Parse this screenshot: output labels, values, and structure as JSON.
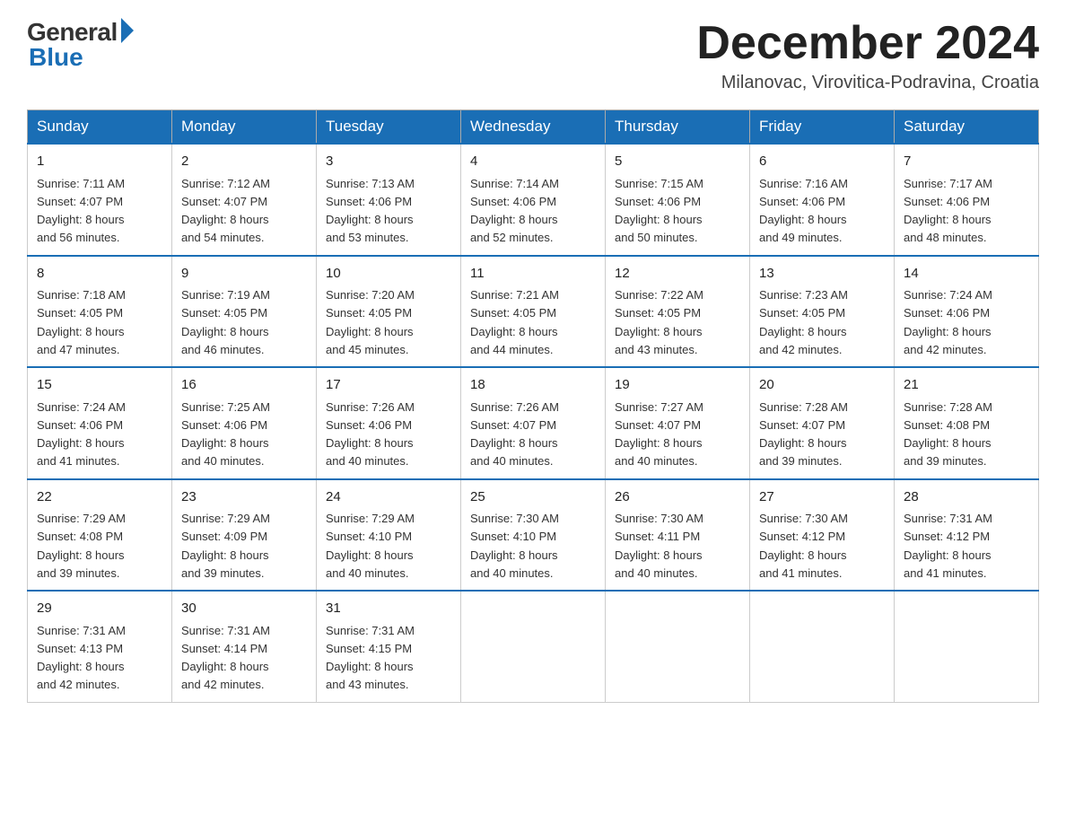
{
  "logo": {
    "general": "General",
    "blue": "Blue"
  },
  "title": {
    "month_year": "December 2024",
    "location": "Milanovac, Virovitica-Podravina, Croatia"
  },
  "headers": [
    "Sunday",
    "Monday",
    "Tuesday",
    "Wednesday",
    "Thursday",
    "Friday",
    "Saturday"
  ],
  "weeks": [
    [
      {
        "day": "1",
        "sunrise": "7:11 AM",
        "sunset": "4:07 PM",
        "daylight": "8 hours and 56 minutes."
      },
      {
        "day": "2",
        "sunrise": "7:12 AM",
        "sunset": "4:07 PM",
        "daylight": "8 hours and 54 minutes."
      },
      {
        "day": "3",
        "sunrise": "7:13 AM",
        "sunset": "4:06 PM",
        "daylight": "8 hours and 53 minutes."
      },
      {
        "day": "4",
        "sunrise": "7:14 AM",
        "sunset": "4:06 PM",
        "daylight": "8 hours and 52 minutes."
      },
      {
        "day": "5",
        "sunrise": "7:15 AM",
        "sunset": "4:06 PM",
        "daylight": "8 hours and 50 minutes."
      },
      {
        "day": "6",
        "sunrise": "7:16 AM",
        "sunset": "4:06 PM",
        "daylight": "8 hours and 49 minutes."
      },
      {
        "day": "7",
        "sunrise": "7:17 AM",
        "sunset": "4:06 PM",
        "daylight": "8 hours and 48 minutes."
      }
    ],
    [
      {
        "day": "8",
        "sunrise": "7:18 AM",
        "sunset": "4:05 PM",
        "daylight": "8 hours and 47 minutes."
      },
      {
        "day": "9",
        "sunrise": "7:19 AM",
        "sunset": "4:05 PM",
        "daylight": "8 hours and 46 minutes."
      },
      {
        "day": "10",
        "sunrise": "7:20 AM",
        "sunset": "4:05 PM",
        "daylight": "8 hours and 45 minutes."
      },
      {
        "day": "11",
        "sunrise": "7:21 AM",
        "sunset": "4:05 PM",
        "daylight": "8 hours and 44 minutes."
      },
      {
        "day": "12",
        "sunrise": "7:22 AM",
        "sunset": "4:05 PM",
        "daylight": "8 hours and 43 minutes."
      },
      {
        "day": "13",
        "sunrise": "7:23 AM",
        "sunset": "4:05 PM",
        "daylight": "8 hours and 42 minutes."
      },
      {
        "day": "14",
        "sunrise": "7:24 AM",
        "sunset": "4:06 PM",
        "daylight": "8 hours and 42 minutes."
      }
    ],
    [
      {
        "day": "15",
        "sunrise": "7:24 AM",
        "sunset": "4:06 PM",
        "daylight": "8 hours and 41 minutes."
      },
      {
        "day": "16",
        "sunrise": "7:25 AM",
        "sunset": "4:06 PM",
        "daylight": "8 hours and 40 minutes."
      },
      {
        "day": "17",
        "sunrise": "7:26 AM",
        "sunset": "4:06 PM",
        "daylight": "8 hours and 40 minutes."
      },
      {
        "day": "18",
        "sunrise": "7:26 AM",
        "sunset": "4:07 PM",
        "daylight": "8 hours and 40 minutes."
      },
      {
        "day": "19",
        "sunrise": "7:27 AM",
        "sunset": "4:07 PM",
        "daylight": "8 hours and 40 minutes."
      },
      {
        "day": "20",
        "sunrise": "7:28 AM",
        "sunset": "4:07 PM",
        "daylight": "8 hours and 39 minutes."
      },
      {
        "day": "21",
        "sunrise": "7:28 AM",
        "sunset": "4:08 PM",
        "daylight": "8 hours and 39 minutes."
      }
    ],
    [
      {
        "day": "22",
        "sunrise": "7:29 AM",
        "sunset": "4:08 PM",
        "daylight": "8 hours and 39 minutes."
      },
      {
        "day": "23",
        "sunrise": "7:29 AM",
        "sunset": "4:09 PM",
        "daylight": "8 hours and 39 minutes."
      },
      {
        "day": "24",
        "sunrise": "7:29 AM",
        "sunset": "4:10 PM",
        "daylight": "8 hours and 40 minutes."
      },
      {
        "day": "25",
        "sunrise": "7:30 AM",
        "sunset": "4:10 PM",
        "daylight": "8 hours and 40 minutes."
      },
      {
        "day": "26",
        "sunrise": "7:30 AM",
        "sunset": "4:11 PM",
        "daylight": "8 hours and 40 minutes."
      },
      {
        "day": "27",
        "sunrise": "7:30 AM",
        "sunset": "4:12 PM",
        "daylight": "8 hours and 41 minutes."
      },
      {
        "day": "28",
        "sunrise": "7:31 AM",
        "sunset": "4:12 PM",
        "daylight": "8 hours and 41 minutes."
      }
    ],
    [
      {
        "day": "29",
        "sunrise": "7:31 AM",
        "sunset": "4:13 PM",
        "daylight": "8 hours and 42 minutes."
      },
      {
        "day": "30",
        "sunrise": "7:31 AM",
        "sunset": "4:14 PM",
        "daylight": "8 hours and 42 minutes."
      },
      {
        "day": "31",
        "sunrise": "7:31 AM",
        "sunset": "4:15 PM",
        "daylight": "8 hours and 43 minutes."
      },
      null,
      null,
      null,
      null
    ]
  ],
  "labels": {
    "sunrise": "Sunrise:",
    "sunset": "Sunset:",
    "daylight": "Daylight:"
  }
}
